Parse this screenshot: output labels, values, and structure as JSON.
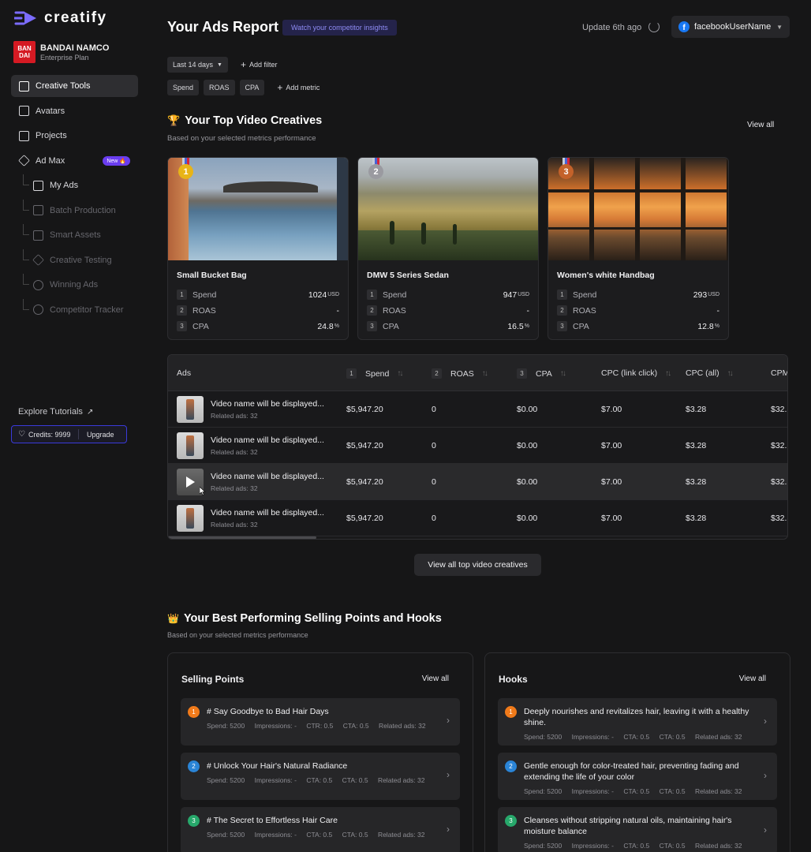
{
  "app": {
    "name": "creatify"
  },
  "org": {
    "logo_top": "BAN",
    "logo_bottom": "DAI",
    "name": "BANDAI NAMCO",
    "plan": "Enterprise Plan"
  },
  "nav": {
    "creative_tools": "Creative Tools",
    "avatars": "Avatars",
    "projects": "Projects",
    "ad_max": "Ad Max",
    "new_badge": "New 🔥",
    "my_ads": "My Ads",
    "batch_production": "Batch Production",
    "smart_assets": "Smart Assets",
    "creative_testing": "Creative Testing",
    "winning_ads": "Winning Ads",
    "competitor_tracker": "Competitor Tracker",
    "explore_tutorials": "Explore Tutorials"
  },
  "credits": {
    "label": "Credits: 9999",
    "upgrade": "Upgrade"
  },
  "header": {
    "title": "Your Ads Report",
    "competitor_btn": "Watch your competitor insights",
    "update": "Update 6th ago",
    "account": "facebookUserName"
  },
  "filters": {
    "date_range": "Last 14 days",
    "add_filter": "Add filter",
    "metrics": [
      "Spend",
      "ROAS",
      "CPA"
    ],
    "add_metric": "Add metric"
  },
  "top_creatives": {
    "title": "Your Top Video Creatives",
    "subtitle": "Based on your selected metrics performance",
    "view_all": "View all",
    "cards": [
      {
        "rank": "1",
        "name": "Small Bucket Bag",
        "metrics": [
          {
            "n": "1",
            "label": "Spend",
            "value": "1024",
            "unit": "USD"
          },
          {
            "n": "2",
            "label": "ROAS",
            "value": "-",
            "unit": ""
          },
          {
            "n": "3",
            "label": "CPA",
            "value": "24.8",
            "unit": "%"
          }
        ]
      },
      {
        "rank": "2",
        "name": "DMW 5 Series Sedan",
        "metrics": [
          {
            "n": "1",
            "label": "Spend",
            "value": "947",
            "unit": "USD"
          },
          {
            "n": "2",
            "label": "ROAS",
            "value": "-",
            "unit": ""
          },
          {
            "n": "3",
            "label": "CPA",
            "value": "16.5",
            "unit": "%"
          }
        ]
      },
      {
        "rank": "3",
        "name": "Women's white Handbag",
        "metrics": [
          {
            "n": "1",
            "label": "Spend",
            "value": "293",
            "unit": "USD"
          },
          {
            "n": "2",
            "label": "ROAS",
            "value": "-",
            "unit": ""
          },
          {
            "n": "3",
            "label": "CPA",
            "value": "12.8",
            "unit": "%"
          }
        ]
      }
    ]
  },
  "table": {
    "headers": {
      "ads": "Ads",
      "spend_n": "1",
      "spend": "Spend",
      "roas_n": "2",
      "roas": "ROAS",
      "cpa_n": "3",
      "cpa": "CPA",
      "cpc_link": "CPC (link click)",
      "cpc_all": "CPC (all)",
      "cpm": "CPM"
    },
    "rows": [
      {
        "name": "Video name will be displayed...",
        "related": "Related ads: 32",
        "spend": "$5,947.20",
        "roas": "0",
        "cpa": "$0.00",
        "cpc_link": "$7.00",
        "cpc_all": "$3.28",
        "cpm": "$32."
      },
      {
        "name": "Video name will be displayed...",
        "related": "Related ads: 32",
        "spend": "$5,947.20",
        "roas": "0",
        "cpa": "$0.00",
        "cpc_link": "$7.00",
        "cpc_all": "$3.28",
        "cpm": "$32."
      },
      {
        "name": "Video name will be displayed...",
        "related": "Related ads: 32",
        "spend": "$5,947.20",
        "roas": "0",
        "cpa": "$0.00",
        "cpc_link": "$7.00",
        "cpc_all": "$3.28",
        "cpm": "$32."
      },
      {
        "name": "Video name will be displayed...",
        "related": "Related ads: 32",
        "spend": "$5,947.20",
        "roas": "0",
        "cpa": "$0.00",
        "cpc_link": "$7.00",
        "cpc_all": "$3.28",
        "cpm": "$32."
      }
    ],
    "view_all_btn": "View all top video creatives"
  },
  "best": {
    "title": "Your Best Performing Selling Points and Hooks",
    "subtitle": "Based on your selected metrics performance",
    "selling": {
      "title": "Selling Points",
      "view_all": "View all",
      "items": [
        {
          "rank": "1",
          "title": "# Say Goodbye to Bad Hair Days",
          "spend": "Spend: 5200",
          "impr": "Impressions: -",
          "m3": "CTR: 0.5",
          "cta": "CTA: 0.5",
          "rel": "Related ads: 32"
        },
        {
          "rank": "2",
          "title": "# Unlock Your Hair's Natural Radiance",
          "spend": "Spend: 5200",
          "impr": "Impressions: -",
          "m3": "CTA: 0.5",
          "cta": "CTA: 0.5",
          "rel": "Related ads: 32"
        },
        {
          "rank": "3",
          "title": "# The Secret to Effortless Hair Care",
          "spend": "Spend: 5200",
          "impr": "Impressions: -",
          "m3": "CTA: 0.5",
          "cta": "CTA: 0.5",
          "rel": "Related ads: 32"
        }
      ]
    },
    "hooks": {
      "title": "Hooks",
      "view_all": "View all",
      "items": [
        {
          "rank": "1",
          "title": "Deeply nourishes and revitalizes hair, leaving it with a healthy shine.",
          "spend": "Spend: 5200",
          "impr": "Impressions: -",
          "m3": "CTA: 0.5",
          "cta": "CTA: 0.5",
          "rel": "Related ads: 32"
        },
        {
          "rank": "2",
          "title": "Gentle enough for color-treated hair, preventing fading and extending the life of your color",
          "spend": "Spend: 5200",
          "impr": "Impressions: -",
          "m3": "CTA: 0.5",
          "cta": "CTA: 0.5",
          "rel": "Related ads: 32"
        },
        {
          "rank": "3",
          "title": "Cleanses without stripping natural oils, maintaining hair's moisture balance",
          "spend": "Spend: 5200",
          "impr": "Impressions: -",
          "m3": "CTA: 0.5",
          "cta": "CTA: 0.5",
          "rel": "Related ads: 32"
        }
      ]
    }
  },
  "colors": {
    "accent": "#6a3df0",
    "rank1": "#f07a1a",
    "rank2": "#2a84d6",
    "rank3": "#27a86b",
    "gold": "#e8b418",
    "silver": "#9a9aa0",
    "bronze": "#c4622a"
  }
}
